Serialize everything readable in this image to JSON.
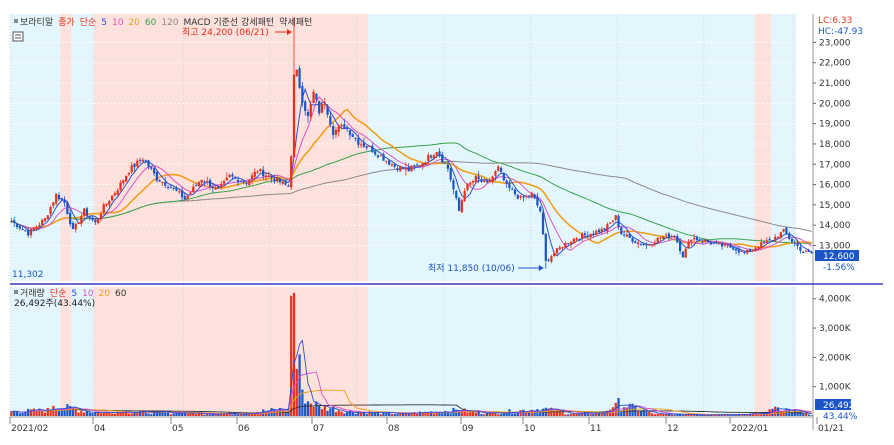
{
  "colors": {
    "up": "#e8311c",
    "down": "#1a56c8",
    "shade_pink": "#fde1dc",
    "shade_blue": "#e4f6fd",
    "ma5": "#2f4fcf",
    "ma10": "#e052c8",
    "ma20": "#f2a01c",
    "ma60": "#37a24b",
    "ma120": "#8a8a8a",
    "axis_text": "#333333",
    "divider": "#3c3cc8"
  },
  "legend_price": [
    {
      "text": "보라티알",
      "color": "#333333"
    },
    {
      "text": "종가",
      "color": "#e8311c"
    },
    {
      "text": "단순",
      "color": "#e8311c"
    },
    {
      "text": "5",
      "color": "#2f4fcf"
    },
    {
      "text": "10",
      "color": "#e052c8"
    },
    {
      "text": "20",
      "color": "#f2a01c"
    },
    {
      "text": "60",
      "color": "#37a24b"
    },
    {
      "text": "120",
      "color": "#8a8a8a"
    },
    {
      "text": "MACD 기준선 강세패턴",
      "color": "#333333"
    },
    {
      "text": "약세패턴",
      "color": "#333333"
    }
  ],
  "legend_volume": [
    {
      "text": "거래량",
      "color": "#333333"
    },
    {
      "text": "단순",
      "color": "#e8311c"
    },
    {
      "text": "5",
      "color": "#2f4fcf"
    },
    {
      "text": "10",
      "color": "#e052c8"
    },
    {
      "text": "20",
      "color": "#f2a01c"
    },
    {
      "text": "60",
      "color": "#333333"
    }
  ],
  "volume_readout": "26,492주(43.44%)",
  "lc_label": "LC:6.33",
  "hc_label": "HC:-47.93",
  "left_value_label": "11,302",
  "chart_data": {
    "type": "candlestick",
    "x_ticks": [
      "2021/02",
      "04",
      "05",
      "06",
      "07",
      "08",
      "09",
      "10",
      "11",
      "12",
      "2022/01",
      "01/21"
    ],
    "price_axis": {
      "ticks": [
        13000,
        14000,
        15000,
        16000,
        17000,
        18000,
        19000,
        20000,
        21000,
        22000,
        23000
      ],
      "tick_labels": [
        "13,000",
        "14,000",
        "15,000",
        "16,000",
        "17,000",
        "18,000",
        "19,000",
        "20,000",
        "21,000",
        "22,000",
        "23,000"
      ],
      "range": [
        11250,
        24400
      ],
      "current_price": "12,600",
      "current_change": "-1.56%"
    },
    "volume_axis": {
      "ticks": [
        1000,
        2000,
        3000,
        4000
      ],
      "tick_labels": [
        "1,000K",
        "2,000K",
        "3,000K",
        "4,000K"
      ],
      "unit": "K",
      "range": [
        0,
        4400
      ],
      "current_volume": "26,492",
      "current_pct": "43.44%"
    },
    "annotations": {
      "high": "최고 24,200 (06/21)",
      "low": "최저 11,850 (10/06)"
    },
    "price_keypoints": [
      {
        "i": 0,
        "close": 14200
      },
      {
        "i": 6,
        "close": 13600
      },
      {
        "i": 12,
        "close": 14300
      },
      {
        "i": 16,
        "close": 15500
      },
      {
        "i": 19,
        "close": 15100
      },
      {
        "i": 22,
        "close": 13700
      },
      {
        "i": 26,
        "close": 14700
      },
      {
        "i": 30,
        "close": 14100
      },
      {
        "i": 33,
        "close": 14900
      },
      {
        "i": 38,
        "close": 15800
      },
      {
        "i": 42,
        "close": 16700
      },
      {
        "i": 47,
        "close": 17300
      },
      {
        "i": 52,
        "close": 16300
      },
      {
        "i": 57,
        "close": 15900
      },
      {
        "i": 62,
        "close": 15300
      },
      {
        "i": 68,
        "close": 16300
      },
      {
        "i": 74,
        "close": 15700
      },
      {
        "i": 78,
        "close": 16400
      },
      {
        "i": 84,
        "close": 16100
      },
      {
        "i": 88,
        "close": 16700
      },
      {
        "i": 95,
        "close": 16200
      },
      {
        "i": 99,
        "close": 15900
      },
      {
        "i": 100,
        "close": 17500
      },
      {
        "i": 101,
        "close": 21300
      },
      {
        "i": 102,
        "close": 21500
      },
      {
        "i": 104,
        "close": 20200
      },
      {
        "i": 106,
        "close": 19300
      },
      {
        "i": 108,
        "close": 20500
      },
      {
        "i": 110,
        "close": 19600
      },
      {
        "i": 112,
        "close": 20100
      },
      {
        "i": 115,
        "close": 18600
      },
      {
        "i": 119,
        "close": 18900
      },
      {
        "i": 124,
        "close": 18100
      },
      {
        "i": 128,
        "close": 17800
      },
      {
        "i": 132,
        "close": 17400
      },
      {
        "i": 137,
        "close": 16900
      },
      {
        "i": 142,
        "close": 16700
      },
      {
        "i": 147,
        "close": 17100
      },
      {
        "i": 152,
        "close": 17700
      },
      {
        "i": 156,
        "close": 16800
      },
      {
        "i": 160,
        "close": 14700
      },
      {
        "i": 162,
        "close": 15800
      },
      {
        "i": 166,
        "close": 16300
      },
      {
        "i": 170,
        "close": 16000
      },
      {
        "i": 174,
        "close": 16800
      },
      {
        "i": 177,
        "close": 15900
      },
      {
        "i": 182,
        "close": 15300
      },
      {
        "i": 186,
        "close": 15500
      },
      {
        "i": 189,
        "close": 14700
      },
      {
        "i": 191,
        "close": 12200
      },
      {
        "i": 193,
        "close": 12500
      },
      {
        "i": 197,
        "close": 13000
      },
      {
        "i": 202,
        "close": 13400
      },
      {
        "i": 207,
        "close": 13600
      },
      {
        "i": 212,
        "close": 13800
      },
      {
        "i": 216,
        "close": 14400
      },
      {
        "i": 218,
        "close": 13600
      },
      {
        "i": 223,
        "close": 13200
      },
      {
        "i": 227,
        "close": 13000
      },
      {
        "i": 232,
        "close": 13400
      },
      {
        "i": 237,
        "close": 13500
      },
      {
        "i": 240,
        "close": 12500
      },
      {
        "i": 243,
        "close": 13400
      },
      {
        "i": 248,
        "close": 13200
      },
      {
        "i": 253,
        "close": 13000
      },
      {
        "i": 258,
        "close": 12900
      },
      {
        "i": 262,
        "close": 12600
      },
      {
        "i": 267,
        "close": 13000
      },
      {
        "i": 272,
        "close": 13300
      },
      {
        "i": 276,
        "close": 13700
      },
      {
        "i": 279,
        "close": 13200
      },
      {
        "i": 283,
        "close": 12700
      },
      {
        "i": 286,
        "close": 12600
      }
    ],
    "volume_keypoints": [
      {
        "i": 0,
        "v": 150
      },
      {
        "i": 14,
        "v": 200
      },
      {
        "i": 15,
        "v": 350
      },
      {
        "i": 30,
        "v": 120
      },
      {
        "i": 40,
        "v": 150
      },
      {
        "i": 60,
        "v": 100
      },
      {
        "i": 80,
        "v": 80
      },
      {
        "i": 99,
        "v": 250
      },
      {
        "i": 100,
        "v": 4100
      },
      {
        "i": 101,
        "v": 4200
      },
      {
        "i": 102,
        "v": 1600
      },
      {
        "i": 103,
        "v": 2100
      },
      {
        "i": 104,
        "v": 900
      },
      {
        "i": 106,
        "v": 500
      },
      {
        "i": 110,
        "v": 350
      },
      {
        "i": 120,
        "v": 150
      },
      {
        "i": 140,
        "v": 80
      },
      {
        "i": 160,
        "v": 200
      },
      {
        "i": 170,
        "v": 90
      },
      {
        "i": 190,
        "v": 250
      },
      {
        "i": 200,
        "v": 70
      },
      {
        "i": 212,
        "v": 120
      },
      {
        "i": 216,
        "v": 450
      },
      {
        "i": 230,
        "v": 60
      },
      {
        "i": 250,
        "v": 50
      },
      {
        "i": 270,
        "v": 80
      },
      {
        "i": 273,
        "v": 320
      },
      {
        "i": 286,
        "v": 26
      }
    ]
  }
}
